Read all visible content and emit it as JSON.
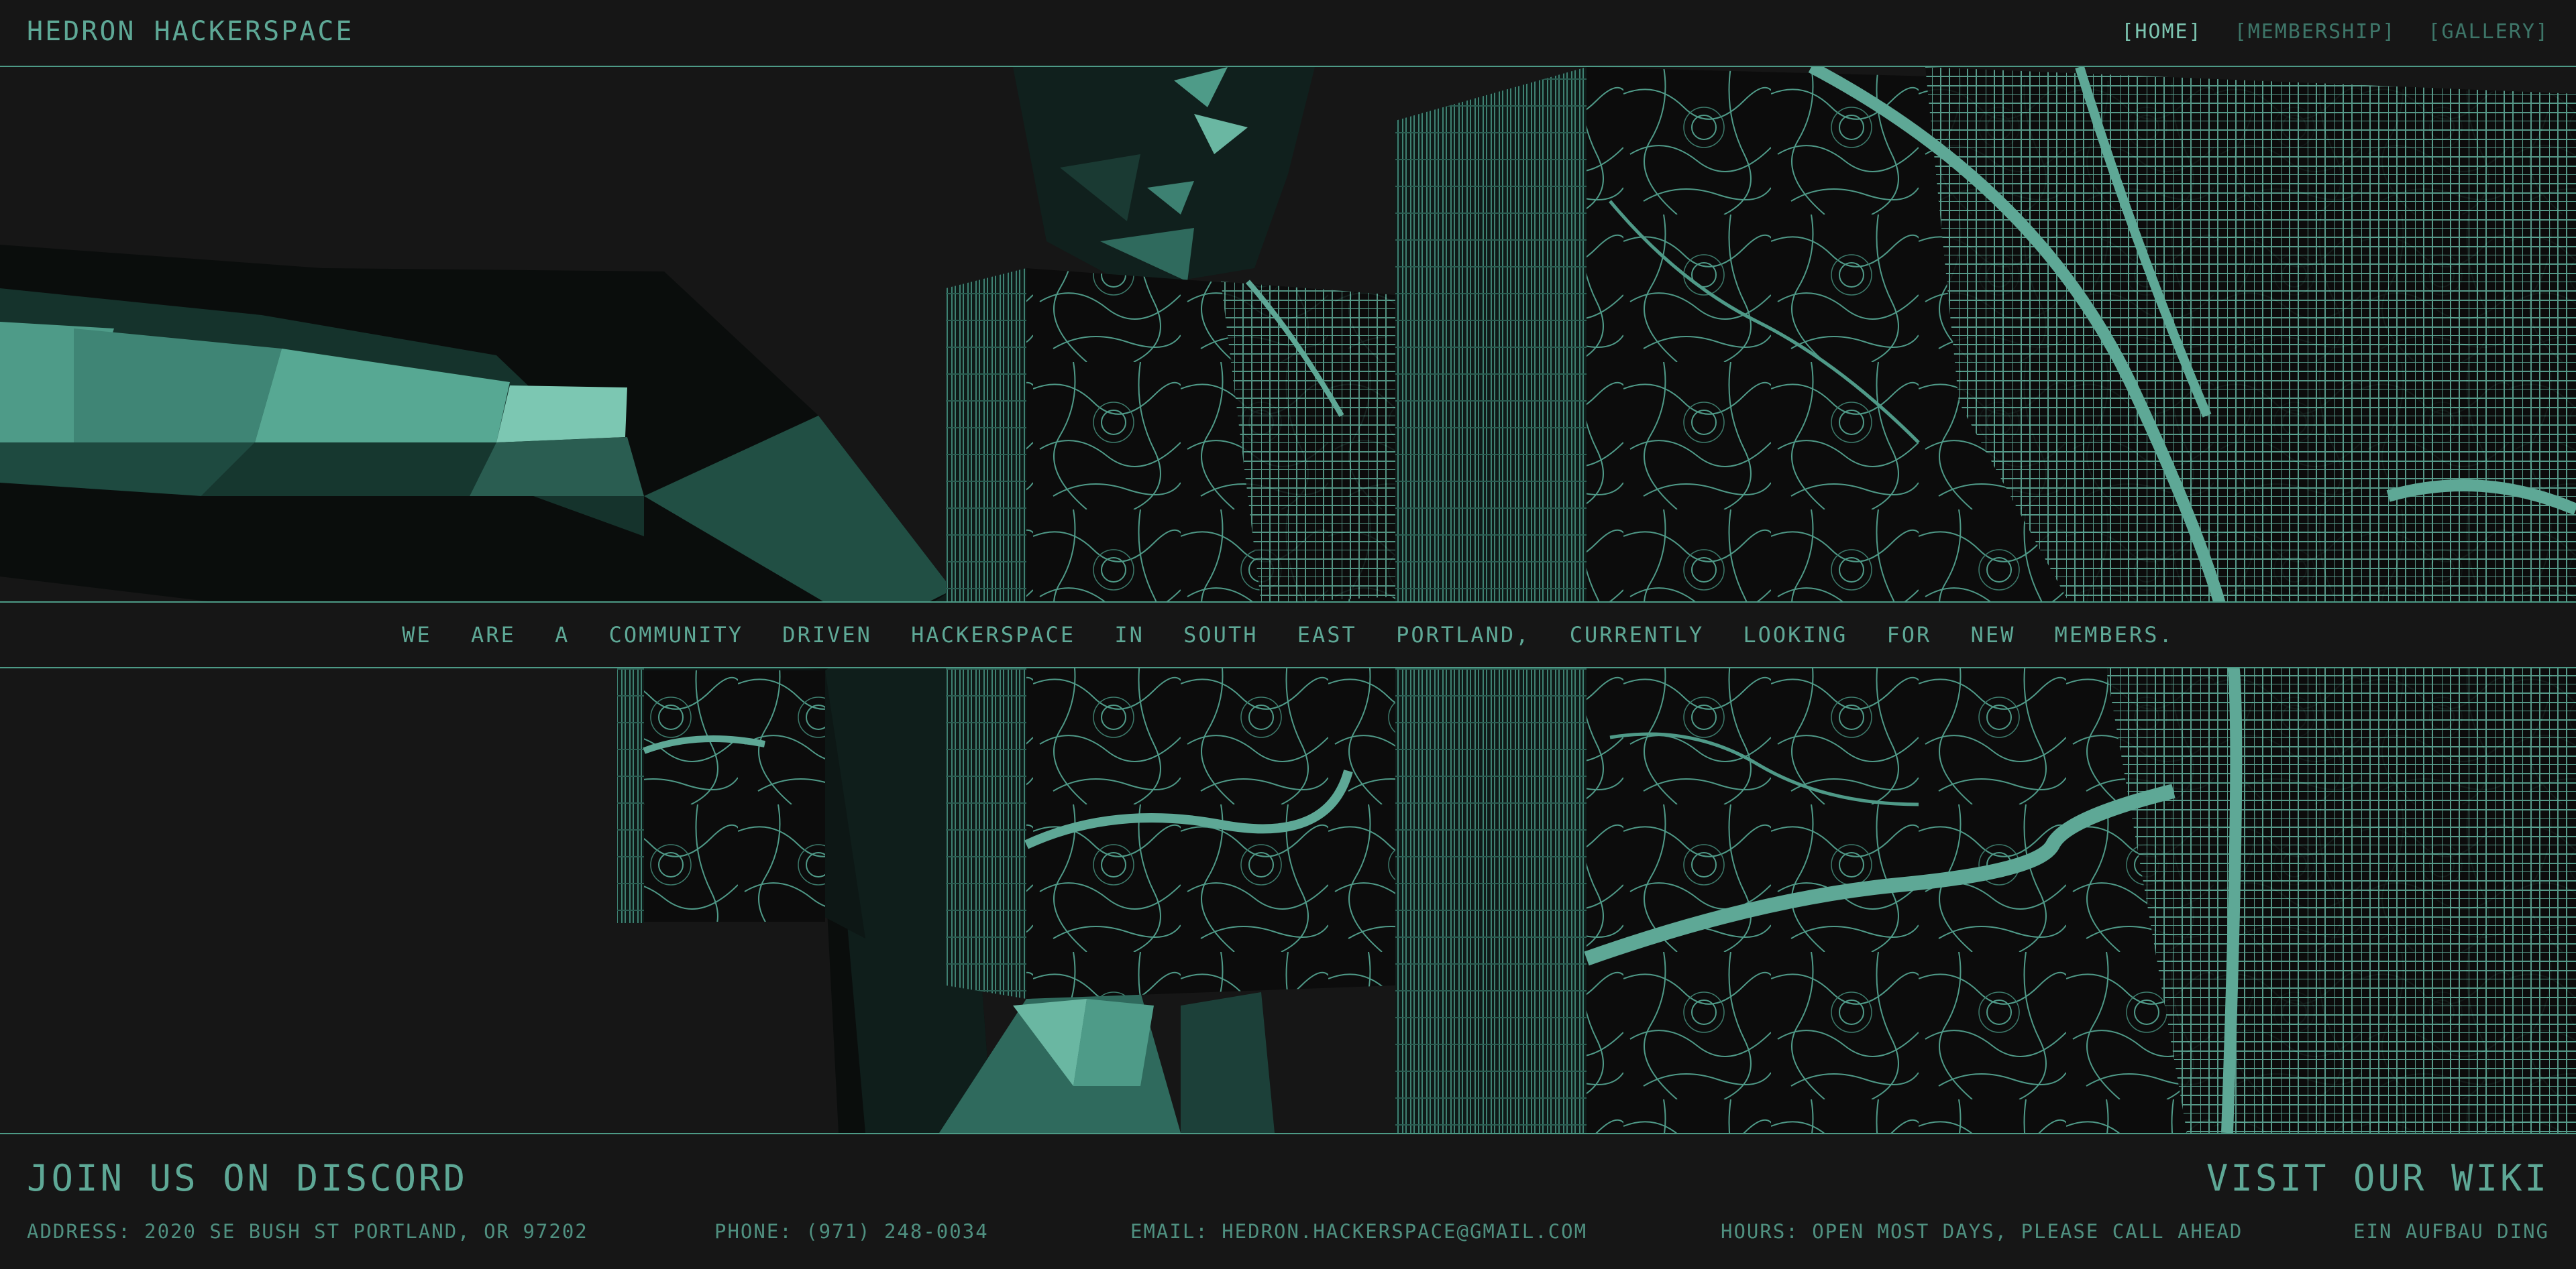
{
  "header": {
    "title": "HEDRON HACKERSPACE",
    "nav": [
      {
        "label": "[HOME]",
        "active": true
      },
      {
        "label": "[MEMBERSHIP]",
        "active": false
      },
      {
        "label": "[GALLERY]",
        "active": false
      }
    ]
  },
  "hero": {
    "tagline": "WE ARE A COMMUNITY DRIVEN HACKERSPACE IN SOUTH EAST PORTLAND, CURRENTLY LOOKING FOR NEW MEMBERS."
  },
  "footer": {
    "discord_label": "JOIN US ON DISCORD",
    "wiki_label": "VISIT OUR WIKI",
    "address": "ADDRESS: 2020 SE BUSH ST PORTLAND, OR 97202",
    "phone": "PHONE: (971) 248-0034",
    "email": "EMAIL: HEDRON.HACKERSPACE@GMAIL.COM",
    "hours": "HOURS: OPEN MOST DAYS, PLEASE CALL AHEAD",
    "credit": "EIN AUFBAU DING"
  },
  "colors": {
    "background": "#161616",
    "accent": "#5ea896",
    "accent_bright": "#7cc4b0",
    "map_fill": "#0c0c0c",
    "map_line": "#5ea896"
  }
}
